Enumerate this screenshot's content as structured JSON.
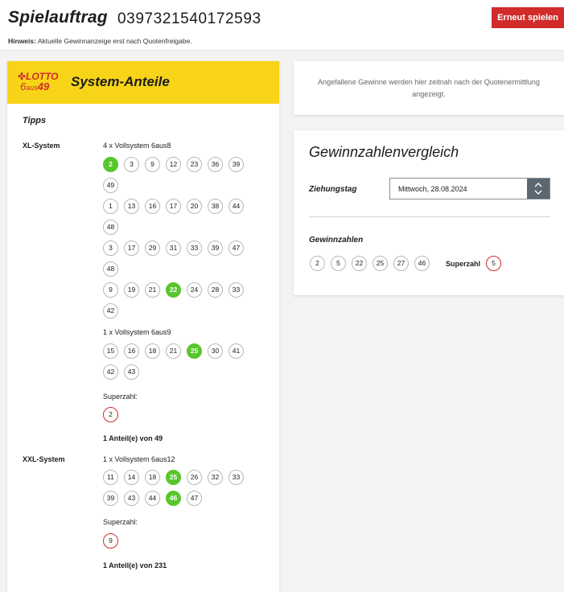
{
  "header": {
    "title": "Spielauftrag",
    "order_number": "0397321540172593",
    "hint_label": "Hinweis:",
    "hint_text": "Aktuelle Gewinnanzeige erst nach Quotenfreigabe.",
    "replay_button": "Erneut spielen"
  },
  "colors": {
    "brand_yellow": "#f7d417",
    "brand_red": "#d12b2b",
    "hit_green": "#57c62c"
  },
  "left": {
    "logo": {
      "word": "LOTTO",
      "six": "6",
      "aus": "aus",
      "fortynine": "49",
      "icon": "clover-icon"
    },
    "section_title": "System-Anteile",
    "tipps_label": "Tipps",
    "xl": {
      "label": "XL-System",
      "description": "4 x Vollsystem 6aus8",
      "rows": [
        [
          {
            "n": "2",
            "hit": true
          },
          {
            "n": "3"
          },
          {
            "n": "9"
          },
          {
            "n": "12"
          },
          {
            "n": "23"
          },
          {
            "n": "36"
          },
          {
            "n": "39"
          }
        ],
        [
          {
            "n": "49"
          }
        ],
        [
          {
            "n": "1"
          },
          {
            "n": "13"
          },
          {
            "n": "16"
          },
          {
            "n": "17"
          },
          {
            "n": "20"
          },
          {
            "n": "38"
          },
          {
            "n": "44"
          }
        ],
        [
          {
            "n": "48"
          }
        ],
        [
          {
            "n": "3"
          },
          {
            "n": "17"
          },
          {
            "n": "29"
          },
          {
            "n": "31"
          },
          {
            "n": "33"
          },
          {
            "n": "39"
          },
          {
            "n": "47"
          }
        ],
        [
          {
            "n": "48"
          }
        ],
        [
          {
            "n": "9"
          },
          {
            "n": "19"
          },
          {
            "n": "21"
          },
          {
            "n": "22",
            "hit": true
          },
          {
            "n": "24"
          },
          {
            "n": "28"
          },
          {
            "n": "33"
          }
        ],
        [
          {
            "n": "42"
          }
        ]
      ],
      "description2": "1 x Vollsystem 6aus9",
      "rows2": [
        [
          {
            "n": "15"
          },
          {
            "n": "16"
          },
          {
            "n": "18"
          },
          {
            "n": "21"
          },
          {
            "n": "25",
            "hit": true
          },
          {
            "n": "30"
          },
          {
            "n": "41"
          }
        ],
        [
          {
            "n": "42"
          },
          {
            "n": "43"
          }
        ]
      ],
      "superzahl_label": "Superzahl:",
      "superzahl": "2",
      "share": "1 Anteil(e) von 49"
    },
    "xxl": {
      "label": "XXL-System",
      "description": "1 x Vollsystem 6aus12",
      "rows": [
        [
          {
            "n": "11"
          },
          {
            "n": "14"
          },
          {
            "n": "18"
          },
          {
            "n": "25",
            "hit": true
          },
          {
            "n": "26"
          },
          {
            "n": "32"
          },
          {
            "n": "33"
          }
        ],
        [
          {
            "n": "39"
          },
          {
            "n": "43"
          },
          {
            "n": "44"
          },
          {
            "n": "46",
            "hit": true
          },
          {
            "n": "47"
          }
        ]
      ],
      "superzahl_label": "Superzahl:",
      "superzahl": "9",
      "share": "1 Anteil(e) von 231"
    }
  },
  "info": {
    "text": "Angefallene Gewinne werden hier zeitnah nach der Quotenermittlung angezeigt."
  },
  "compare": {
    "title": "Gewinnzahlenvergleich",
    "draw_label": "Ziehungstag",
    "draw_value": "Mittwoch, 28.08.2024",
    "winning_label": "Gewinnzahlen",
    "winning_numbers": [
      "2",
      "5",
      "22",
      "25",
      "27",
      "46"
    ],
    "superzahl_label": "Superzahl",
    "superzahl": "5"
  }
}
